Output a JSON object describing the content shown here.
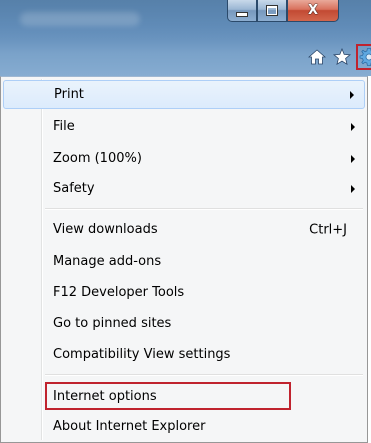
{
  "window": {
    "caption_buttons": {
      "minimize_icon": "minimize-icon",
      "maximize_icon": "maximize-icon",
      "close_glyph": "X"
    }
  },
  "toolbar": {
    "icons": [
      "home-icon",
      "favorites-star-icon",
      "tools-gear-icon"
    ]
  },
  "menu": {
    "items": [
      {
        "label": "Print",
        "submenu": true,
        "shortcut": ""
      },
      {
        "label": "File",
        "submenu": true,
        "shortcut": ""
      },
      {
        "label": "Zoom (100%)",
        "submenu": true,
        "shortcut": ""
      },
      {
        "label": "Safety",
        "submenu": true,
        "shortcut": ""
      },
      {
        "label": "View downloads",
        "submenu": false,
        "shortcut": "Ctrl+J"
      },
      {
        "label": "Manage add-ons",
        "submenu": false,
        "shortcut": ""
      },
      {
        "label": "F12 Developer Tools",
        "submenu": false,
        "shortcut": ""
      },
      {
        "label": "Go to pinned sites",
        "submenu": false,
        "shortcut": ""
      },
      {
        "label": "Compatibility View settings",
        "submenu": false,
        "shortcut": ""
      },
      {
        "label": "Internet options",
        "submenu": false,
        "shortcut": ""
      },
      {
        "label": "About Internet Explorer",
        "submenu": false,
        "shortcut": ""
      }
    ]
  },
  "colors": {
    "highlight_red": "#c0232e",
    "hover_blue": "#dcebfc",
    "titlebar_blue": "#5a87b5"
  }
}
